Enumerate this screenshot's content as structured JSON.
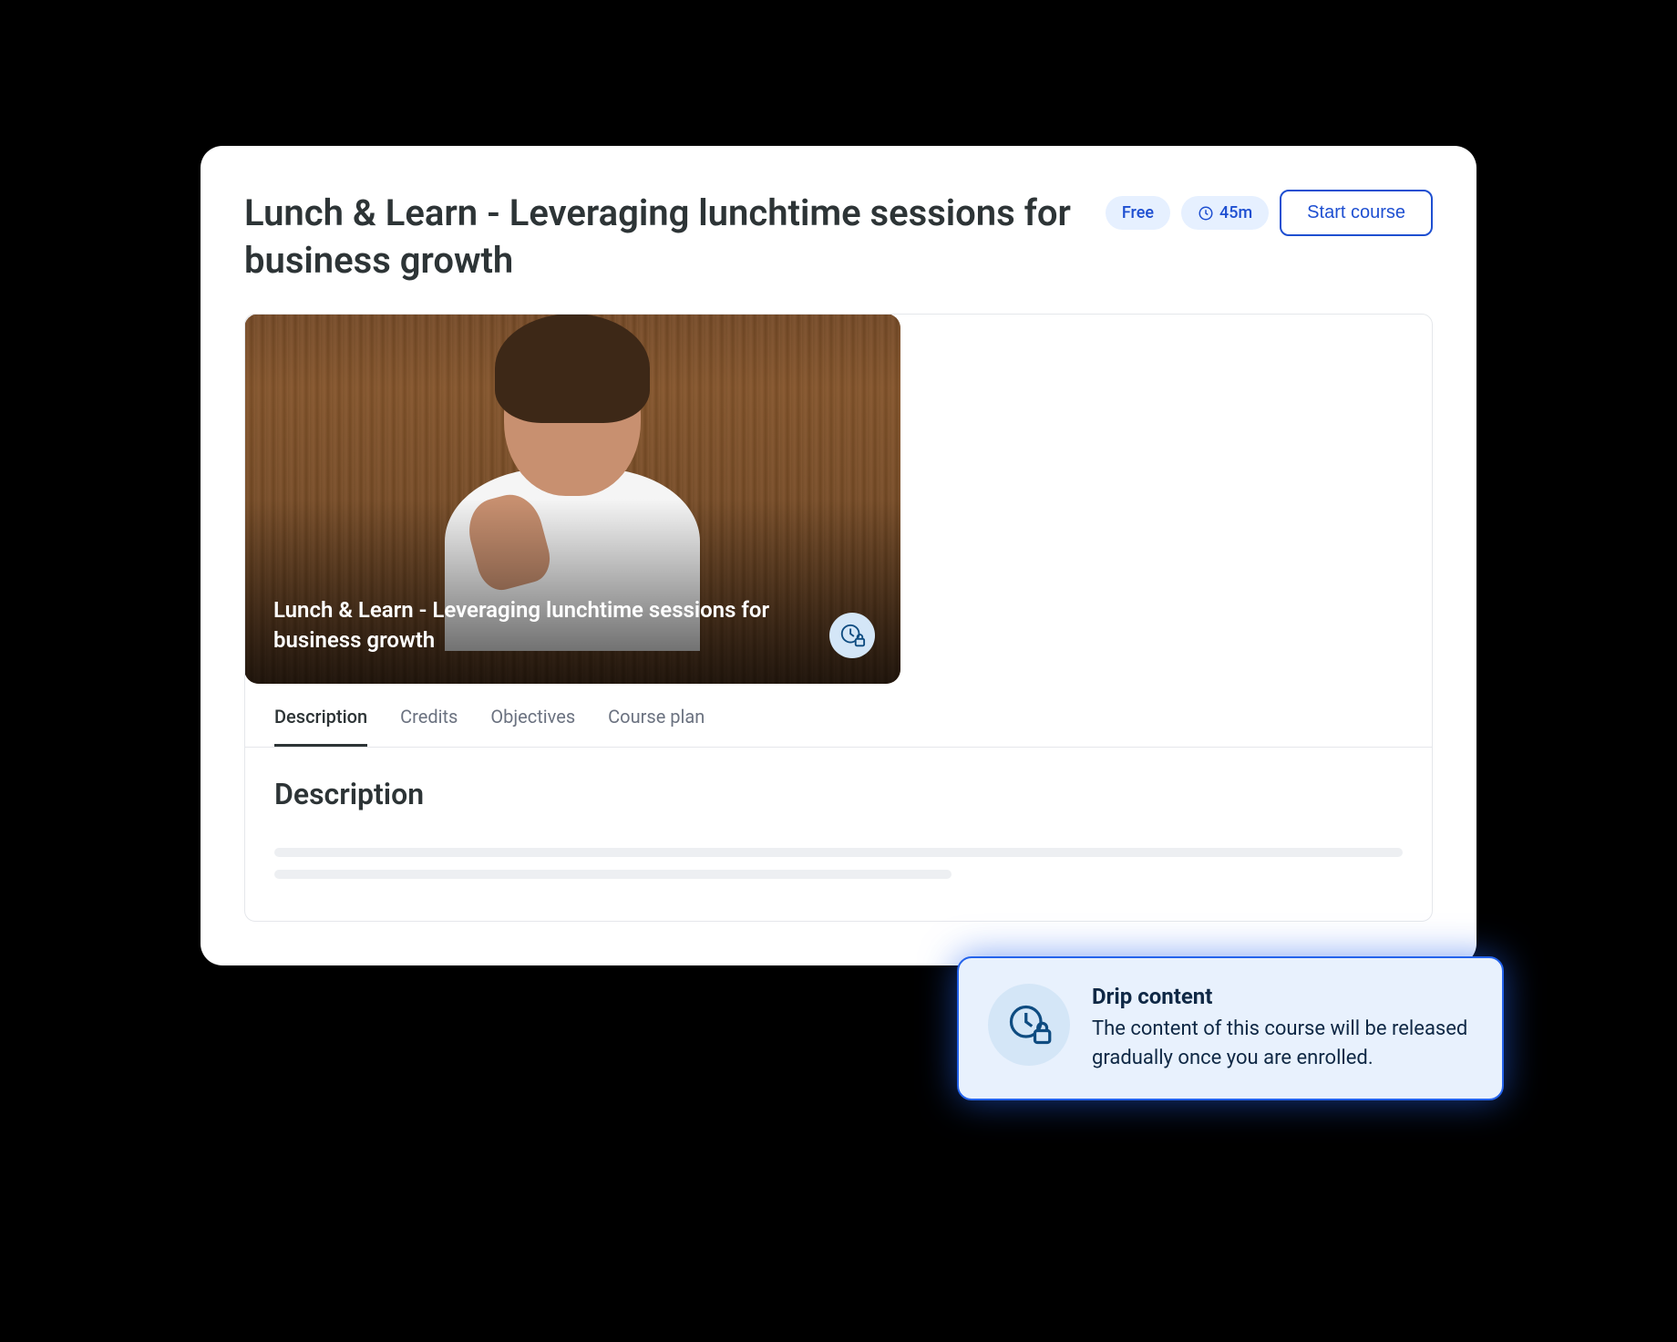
{
  "header": {
    "title": "Lunch & Learn - Leveraging lunchtime sessions for business growth",
    "price_badge": "Free",
    "duration_badge": "45m",
    "start_button": "Start course"
  },
  "hero": {
    "title": "Lunch & Learn - Leveraging lunchtime sessions for business growth"
  },
  "tabs": [
    {
      "label": "Description",
      "active": true
    },
    {
      "label": "Credits",
      "active": false
    },
    {
      "label": "Objectives",
      "active": false
    },
    {
      "label": "Course plan",
      "active": false
    }
  ],
  "section": {
    "heading": "Description"
  },
  "callout": {
    "title": "Drip content",
    "text": "The content of this course will be released gradually once you are enrolled."
  }
}
